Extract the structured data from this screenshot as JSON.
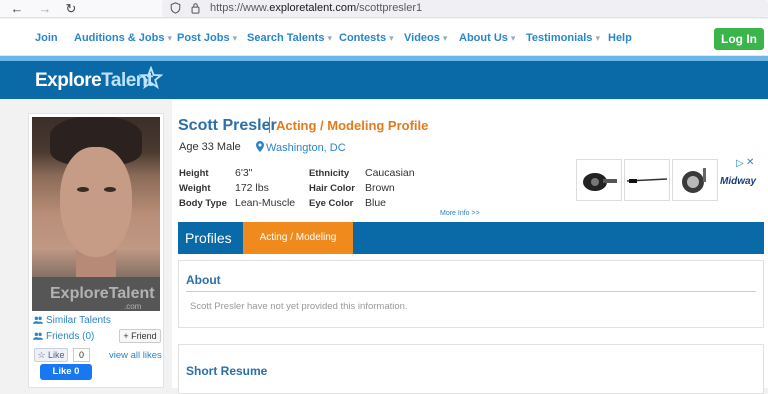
{
  "browser": {
    "url_prefix": "https://www.",
    "url_domain": "exploretalent.com",
    "url_path": "/scottpresler1"
  },
  "nav": {
    "items": [
      {
        "label": "Join",
        "dropdown": false
      },
      {
        "label": "Auditions & Jobs",
        "dropdown": true
      },
      {
        "label": "Post Jobs",
        "dropdown": true
      },
      {
        "label": "Search Talents",
        "dropdown": true
      },
      {
        "label": "Contests",
        "dropdown": true
      },
      {
        "label": "Videos",
        "dropdown": true
      },
      {
        "label": "About Us",
        "dropdown": true
      },
      {
        "label": "Testimonials",
        "dropdown": true
      },
      {
        "label": "Help",
        "dropdown": false
      }
    ],
    "login_label": "Log In"
  },
  "brand": {
    "logo_part1": "Explore",
    "logo_part2": "Talent"
  },
  "sidebar": {
    "photo_watermark": "ExploreTalent",
    "photo_watermark_sub": ".com",
    "similar_talents": "Similar Talents",
    "friends": "Friends (0)",
    "add_friend": "+ Friend",
    "like_label": "Like",
    "like_count": "0",
    "view_all_likes": "view all likes",
    "fb_like": "Like 0"
  },
  "profile": {
    "name": "Scott Presler",
    "type": "Acting / Modeling Profile",
    "age_gender": "Age 33 Male",
    "location": "Washington, DC",
    "attributes": [
      {
        "label": "Height",
        "value": "6'3\""
      },
      {
        "label": "Weight",
        "value": "172 lbs"
      },
      {
        "label": "Body Type",
        "value": "Lean-Muscle"
      },
      {
        "label": "Ethnicity",
        "value": "Caucasian"
      },
      {
        "label": "Hair Color",
        "value": "Brown"
      },
      {
        "label": "Eye Color",
        "value": "Blue"
      }
    ],
    "more_info": "More Info >>"
  },
  "ad": {
    "brand": "Midway"
  },
  "tabs": {
    "profiles_label": "Profiles",
    "active_tab": "Acting / Modeling"
  },
  "about": {
    "title": "About",
    "text": "Scott Presler have not yet provided this information."
  },
  "resume": {
    "title": "Short Resume"
  },
  "colors": {
    "brand_blue": "#0a6aa8",
    "link_blue": "#2a86c8",
    "accent_orange": "#f08a1c",
    "login_green": "#39b54a"
  }
}
